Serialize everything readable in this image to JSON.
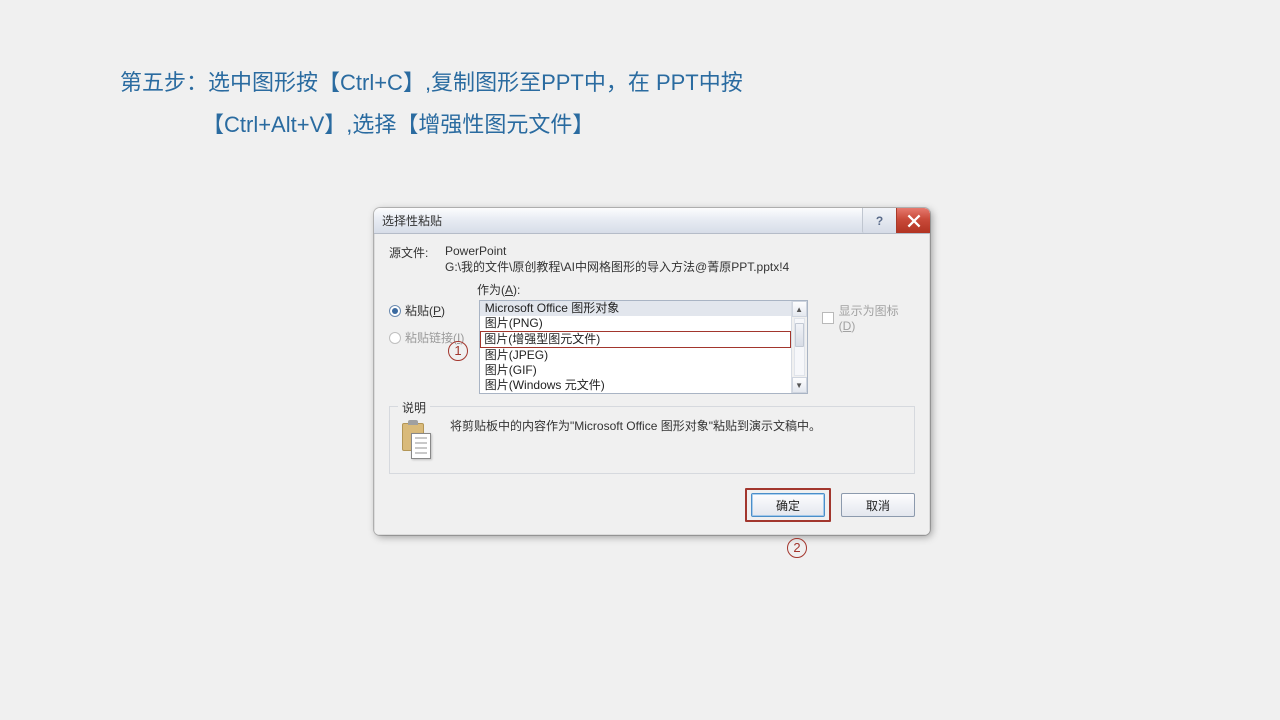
{
  "instruction": {
    "line1": "第五步：选中图形按【Ctrl+C】,复制图形至PPT中，在  PPT中按",
    "line2": "【Ctrl+Alt+V】,选择【增强性图元文件】"
  },
  "dialog": {
    "title": "选择性粘贴",
    "source_label": "源文件:",
    "source_app": "PowerPoint",
    "source_path": "G:\\我的文件\\原创教程\\AI中网格图形的导入方法@菁原PPT.pptx!4",
    "as_label_prefix": "作为(",
    "as_label_key": "A",
    "as_label_suffix": "):",
    "radio_paste_prefix": "粘贴(",
    "radio_paste_key": "P",
    "radio_paste_suffix": ")",
    "radio_link_prefix": "粘贴链接(",
    "radio_link_key": "I",
    "radio_link_suffix": ")",
    "options": [
      "Microsoft Office 图形对象",
      "图片(PNG)",
      "图片(增强型图元文件)",
      "图片(JPEG)",
      "图片(GIF)",
      "图片(Windows 元文件)"
    ],
    "show_icon_prefix": "显示为图标(",
    "show_icon_key": "D",
    "show_icon_suffix": ")",
    "desc_legend": "说明",
    "desc_text": "将剪贴板中的内容作为\"Microsoft Office 图形对象\"粘贴到演示文稿中。",
    "ok_label": "确定",
    "cancel_label": "取消"
  },
  "annotations": {
    "a1": "1",
    "a2": "2"
  }
}
